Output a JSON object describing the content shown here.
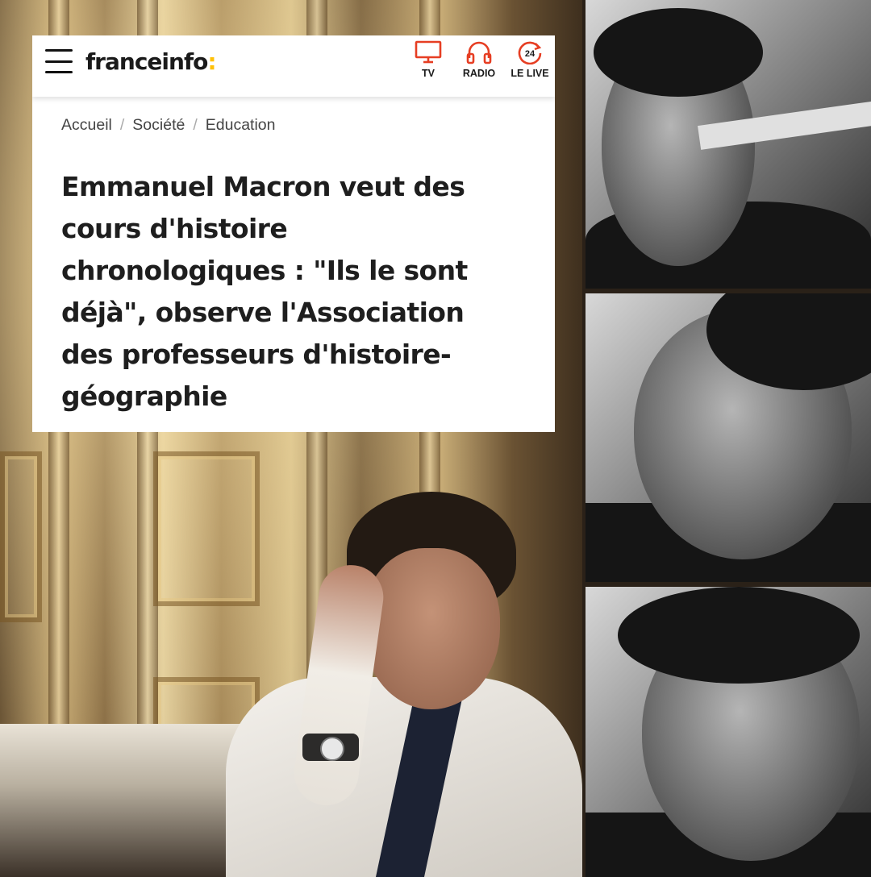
{
  "header": {
    "logo_text": "franceinfo",
    "logo_colon": ":",
    "accent_color": "#ffc107",
    "nav_accent_color": "#e63e23",
    "nav": [
      {
        "label": "TV",
        "icon": "tv-icon"
      },
      {
        "label": "RADIO",
        "icon": "headphones-icon"
      },
      {
        "label": "LE LIVE",
        "icon": "live-24-icon",
        "icon_text": "24"
      }
    ]
  },
  "breadcrumb": [
    "Accueil",
    "Société",
    "Education"
  ],
  "article": {
    "title": "Emmanuel Macron veut des cours d'histoire chronologiques : \"Ils le sont déjà\", observe l'Association des professeurs d'histoire-géographie"
  }
}
